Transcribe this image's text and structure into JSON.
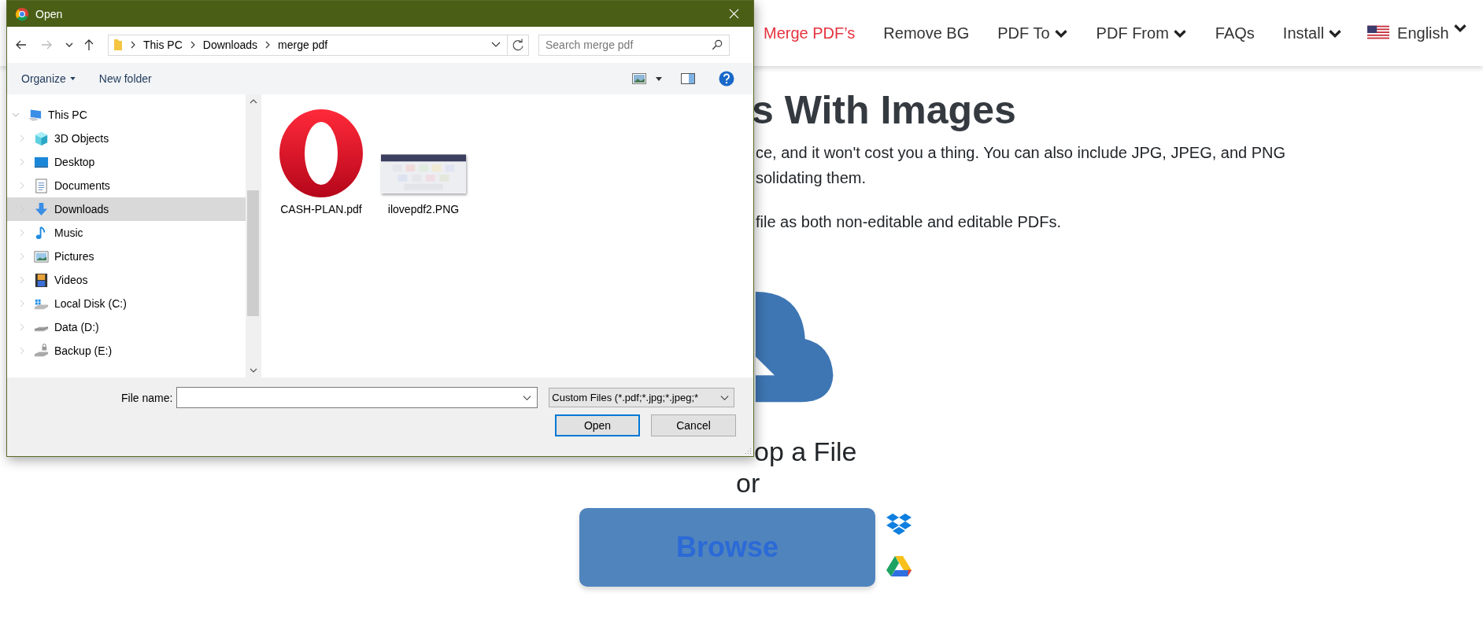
{
  "nav": [
    {
      "label": "Merge PDF’s",
      "selected": true,
      "dropdown": false
    },
    {
      "label": "Remove BG",
      "selected": false,
      "dropdown": false
    },
    {
      "label": "PDF To",
      "selected": false,
      "dropdown": true
    },
    {
      "label": "PDF From",
      "selected": false,
      "dropdown": true
    },
    {
      "label": "FAQs",
      "selected": false,
      "dropdown": false
    },
    {
      "label": "Install",
      "selected": false,
      "dropdown": true
    }
  ],
  "language": "English",
  "heading": "s With Images",
  "intro_lines": [
    "ce, and it won't cost you a thing. You can also include JPG, JPEG, and PNG",
    "solidating them."
  ],
  "note_line": "file as both non-editable and editable PDFs.",
  "drop_text": "op a File",
  "or_text": "or",
  "browse": "Browse",
  "dialog": {
    "title": "Open",
    "path": [
      "This PC",
      "Downloads",
      "merge pdf"
    ],
    "search": {
      "placeholder": "Search merge pdf"
    },
    "toolbar": [
      {
        "label": "Organize",
        "menu": true
      },
      {
        "label": "New folder",
        "menu": false
      }
    ],
    "tree": [
      {
        "label": "This PC",
        "kind": "pc",
        "expanded": true,
        "selected": false,
        "children": [
          {
            "label": "3D Objects",
            "kind": "cube",
            "expanded": false,
            "selected": false
          },
          {
            "label": "Desktop",
            "kind": "desktop",
            "expanded": false,
            "selected": false
          },
          {
            "label": "Documents",
            "kind": "document",
            "expanded": false,
            "selected": false
          },
          {
            "label": "Downloads",
            "kind": "download",
            "expanded": false,
            "selected": true
          },
          {
            "label": "Music",
            "kind": "music",
            "expanded": false,
            "selected": false
          },
          {
            "label": "Pictures",
            "kind": "pictures",
            "expanded": false,
            "selected": false
          },
          {
            "label": "Videos",
            "kind": "video",
            "expanded": false,
            "selected": false
          },
          {
            "label": "Local Disk (C:)",
            "kind": "system-drive",
            "expanded": false,
            "selected": false
          },
          {
            "label": "Data (D:)",
            "kind": "drive",
            "expanded": false,
            "selected": false
          },
          {
            "label": "Backup (E:)",
            "kind": "locked-drive",
            "expanded": false,
            "selected": false
          }
        ]
      }
    ],
    "files": [
      {
        "name": "CASH-PLAN.pdf",
        "kind": "ring"
      },
      {
        "name": "ilovepdf2.PNG",
        "kind": "thumbnail"
      }
    ],
    "file_name": {
      "label": "File name:"
    },
    "file_type": "Custom Files (*.pdf;*.jpg;*.jpeg;*",
    "buttons": [
      {
        "label": "Open",
        "default": true
      },
      {
        "label": "Cancel",
        "default": false
      }
    ]
  }
}
